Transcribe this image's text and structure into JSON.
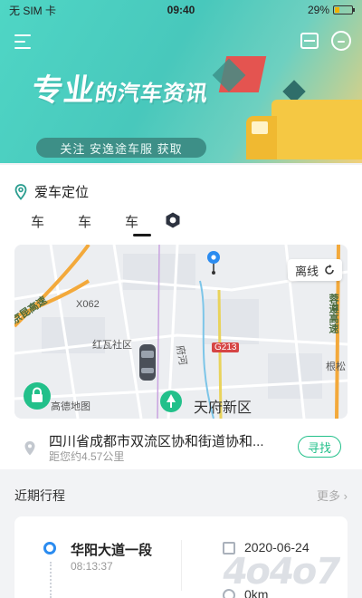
{
  "status": {
    "carrier": "无 SIM 卡",
    "time": "09:40",
    "battery": "29%",
    "battery_level": 0.29
  },
  "banner": {
    "headline_a": "专业",
    "headline_b": "的",
    "headline_c": "汽车资讯",
    "cta": "关注 安逸途车服 获取"
  },
  "location": {
    "title": "爱车定位"
  },
  "tabs": [
    "车",
    "车",
    "车"
  ],
  "map": {
    "offline_label": "离线",
    "labels": {
      "road_a": "京昆高速",
      "x062": "X062",
      "hongwa": "红瓦社区",
      "fuhe": "府河",
      "g213": "G213",
      "rongzun": "蓉遵高速",
      "genpo": "根松",
      "gaode": "高德地图",
      "tianfu": "天府新区"
    }
  },
  "address": {
    "text": "四川省成都市双流区协和街道协和...",
    "distance": "距您约4.57公里",
    "find_button": "寻找"
  },
  "trips": {
    "title": "近期行程",
    "more": "更多",
    "item": {
      "place": "华阳大道一段",
      "time": "08:13:37",
      "date": "2020-06-24",
      "distance": "0km"
    }
  },
  "watermark": "4o4o7",
  "colors": {
    "accent_green": "#22c08a",
    "accent_blue": "#2b8cf0",
    "banner_teal": "#4fd6c5"
  }
}
